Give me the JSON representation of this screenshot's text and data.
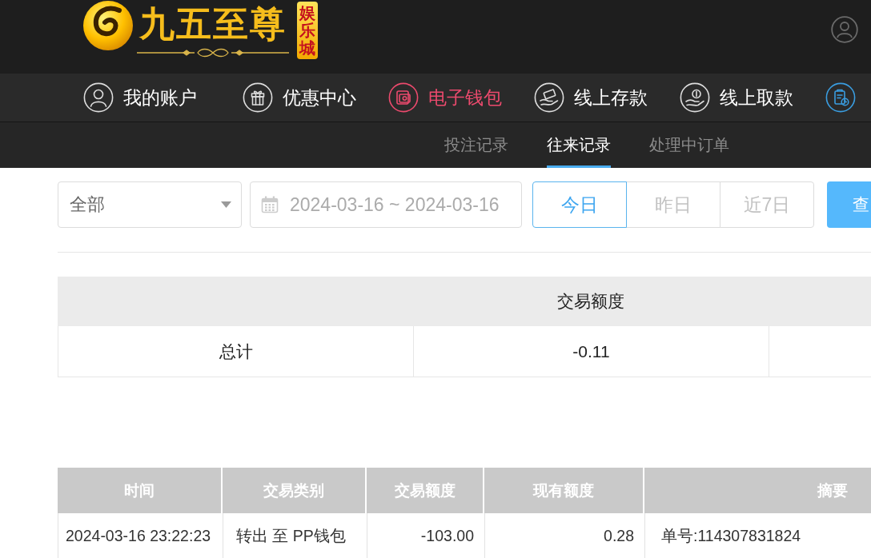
{
  "header": {
    "logo": {
      "name": "九五至尊",
      "tag": "娱乐城"
    }
  },
  "nav": {
    "items": [
      {
        "label": "我的账户",
        "selected": false
      },
      {
        "label": "优惠中心",
        "selected": false
      },
      {
        "label": "电子钱包",
        "selected": true
      },
      {
        "label": "线上存款",
        "selected": false
      },
      {
        "label": "线上取款",
        "selected": false
      }
    ]
  },
  "subtabs": [
    {
      "label": "投注记录",
      "selected": false
    },
    {
      "label": "往来记录",
      "selected": true
    },
    {
      "label": "处理中订单",
      "selected": false
    }
  ],
  "filters": {
    "type_select": {
      "value": "全部"
    },
    "date_range": {
      "value": "2024-03-16 ~ 2024-03-16"
    },
    "quick_ranges": [
      {
        "label": "今日",
        "selected": true
      },
      {
        "label": "昨日",
        "selected": false
      },
      {
        "label": "近7日",
        "selected": false
      }
    ],
    "search_button": {
      "label": "查"
    }
  },
  "summary_table": {
    "header": "交易额度",
    "rows": [
      {
        "label": "总计",
        "amount": "-0.11"
      }
    ]
  },
  "transactions_table": {
    "columns": [
      "时间",
      "交易类别",
      "交易额度",
      "现有额度",
      "摘要"
    ],
    "rows": [
      {
        "cells": [
          "2024-03-16 23:22:23",
          "转出 至 PP钱包",
          "-103.00",
          "0.28",
          "单号:114307831824"
        ]
      }
    ]
  }
}
